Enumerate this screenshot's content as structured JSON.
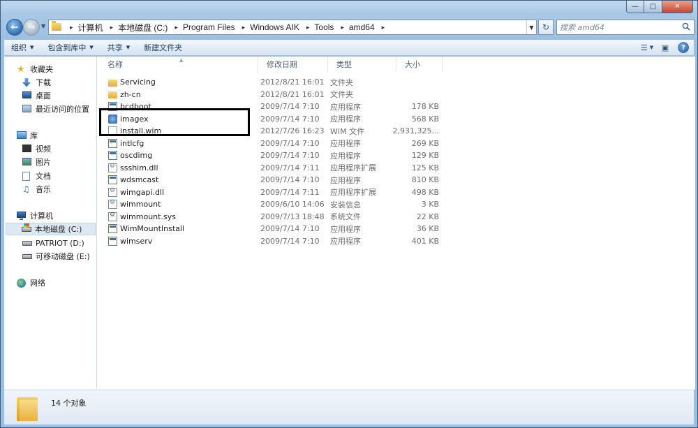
{
  "window": {
    "caption": {
      "minimize": "—",
      "maximize": "□",
      "close": "✕"
    }
  },
  "address": {
    "separator": "▸",
    "crumbs": [
      "计算机",
      "本地磁盘 (C:)",
      "Program Files",
      "Windows AIK",
      "Tools",
      "amd64"
    ]
  },
  "search": {
    "placeholder": "搜索 amd64"
  },
  "toolbar": {
    "organize": "组织",
    "include_in_library": "包含到库中",
    "share": "共享",
    "new_folder": "新建文件夹"
  },
  "sidebar": {
    "favorites": {
      "label": "收藏夹",
      "items": [
        "下载",
        "桌面",
        "最近访问的位置"
      ]
    },
    "libraries": {
      "label": "库",
      "items": [
        "视频",
        "图片",
        "文档",
        "音乐"
      ]
    },
    "computer": {
      "label": "计算机",
      "items": [
        "本地磁盘 (C:)",
        "PATRIOT (D:)",
        "可移动磁盘 (E:)"
      ]
    },
    "network": {
      "label": "网络"
    }
  },
  "columns": {
    "name": "名称",
    "date": "修改日期",
    "type": "类型",
    "size": "大小"
  },
  "files": [
    {
      "icon": "folder-icon",
      "name": "Servicing",
      "date": "2012/8/21 16:01",
      "type": "文件夹",
      "size": ""
    },
    {
      "icon": "folder-icon",
      "name": "zh-cn",
      "date": "2012/8/21 16:01",
      "type": "文件夹",
      "size": ""
    },
    {
      "icon": "application-icon",
      "name": "bcdboot",
      "date": "2009/7/14 7:10",
      "type": "应用程序",
      "size": "178 KB"
    },
    {
      "icon": "imagex-icon",
      "name": "imagex",
      "date": "2009/7/14 7:10",
      "type": "应用程序",
      "size": "568 KB"
    },
    {
      "icon": "blank-file-icon",
      "name": "install.wim",
      "date": "2012/7/26 16:23",
      "type": "WIM 文件",
      "size": "2,931,325..."
    },
    {
      "icon": "application-icon",
      "name": "intlcfg",
      "date": "2009/7/14 7:10",
      "type": "应用程序",
      "size": "269 KB"
    },
    {
      "icon": "application-icon",
      "name": "oscdimg",
      "date": "2009/7/14 7:10",
      "type": "应用程序",
      "size": "129 KB"
    },
    {
      "icon": "dll-icon",
      "name": "ssshim.dll",
      "date": "2009/7/14 7:11",
      "type": "应用程序扩展",
      "size": "125 KB"
    },
    {
      "icon": "application-icon",
      "name": "wdsmcast",
      "date": "2009/7/14 7:10",
      "type": "应用程序",
      "size": "810 KB"
    },
    {
      "icon": "dll-icon",
      "name": "wimgapi.dll",
      "date": "2009/7/14 7:11",
      "type": "应用程序扩展",
      "size": "498 KB"
    },
    {
      "icon": "setup-info-icon",
      "name": "wimmount",
      "date": "2009/6/10 14:06",
      "type": "安装信息",
      "size": "3 KB"
    },
    {
      "icon": "system-file-icon",
      "name": "wimmount.sys",
      "date": "2009/7/13 18:48",
      "type": "系统文件",
      "size": "22 KB"
    },
    {
      "icon": "application-icon",
      "name": "WimMountInstall",
      "date": "2009/7/14 7:10",
      "type": "应用程序",
      "size": "36 KB"
    },
    {
      "icon": "application-icon",
      "name": "wimserv",
      "date": "2009/7/14 7:10",
      "type": "应用程序",
      "size": "401 KB"
    }
  ],
  "details": {
    "count_text": "14 个对象"
  },
  "colors": {
    "accent": "#2f6fb3",
    "selection": "#dde8f3",
    "frame": "#9bbfe2",
    "highlight_box": "#000000"
  }
}
